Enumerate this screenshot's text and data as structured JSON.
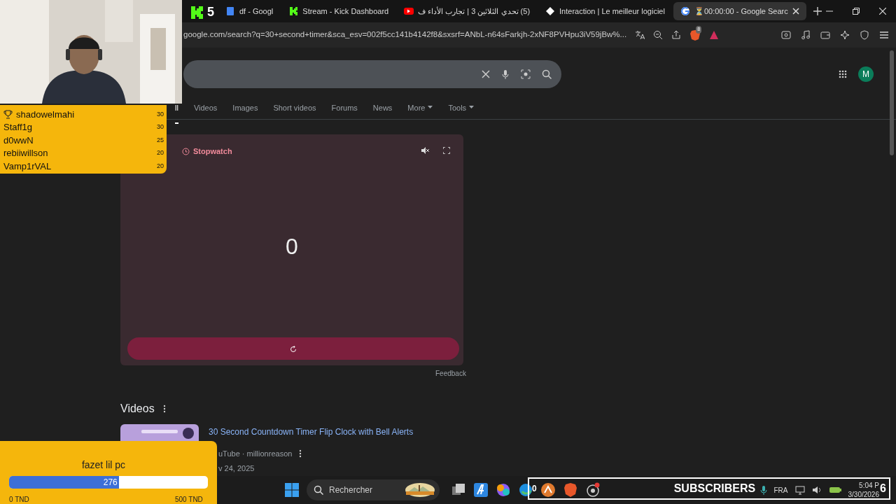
{
  "browser": {
    "tabs": [
      {
        "kind": "doc",
        "title": "df - Googl",
        "selected": false
      },
      {
        "kind": "kick",
        "title": "Stream - Kick Dashboard",
        "selected": false
      },
      {
        "kind": "youtube",
        "title": "(5) تحدي الثلاثين 3 | تجارب الأداء ف",
        "selected": false
      },
      {
        "kind": "diamond",
        "title": "Interaction | Le meilleur logiciel",
        "selected": false
      },
      {
        "kind": "google",
        "title": "⏳00:00:00 - Google Searc",
        "selected": true
      }
    ],
    "address": "google.com/search?q=30+second+timer&sca_esv=002f5cc141b4142f8&sxsrf=ANbL-n64sFarkjh-2xNF8PVHpu3iV59jBw%...",
    "shield_count": "8"
  },
  "google": {
    "avatar": "M",
    "nav": [
      {
        "label": "ll",
        "selected": true,
        "menu": false
      },
      {
        "label": "Videos",
        "selected": false,
        "menu": false
      },
      {
        "label": "Images",
        "selected": false,
        "menu": false
      },
      {
        "label": "Short videos",
        "selected": false,
        "menu": false
      },
      {
        "label": "Forums",
        "selected": false,
        "menu": false
      },
      {
        "label": "News",
        "selected": false,
        "menu": false
      },
      {
        "label": "More",
        "selected": false,
        "menu": true
      },
      {
        "label": "Tools",
        "selected": false,
        "menu": true
      }
    ],
    "stopwatch": {
      "title": "Stopwatch",
      "display": "0",
      "feedback": "Feedback"
    },
    "videos": {
      "heading": "Videos",
      "results": [
        {
          "title": "30 Second Countdown Timer Flip Clock with Bell Alerts",
          "source": "uTube · millionreason",
          "date": "v 24, 2025"
        }
      ]
    }
  },
  "taskbar": {
    "search": "Rechercher",
    "language": "FRA",
    "time": "5:04 P",
    "date": "3/30/2026"
  },
  "overlay": {
    "kick_count": "5",
    "leaderboard": [
      {
        "name": "shadowelmahi",
        "score": "30",
        "trophy": true
      },
      {
        "name": "Staff1g",
        "score": "30",
        "trophy": false
      },
      {
        "name": "d0wwN",
        "score": "25",
        "trophy": false
      },
      {
        "name": "rebiiwillson",
        "score": "20",
        "trophy": false
      },
      {
        "name": "Vamp1rVAL",
        "score": "20",
        "trophy": false
      }
    ],
    "goal": {
      "title": "fazet lil pc",
      "amount": "276",
      "level": 0.552,
      "min": "0 TND",
      "max": "500 TND"
    },
    "subscribers": {
      "left_count": "0",
      "label": "SUBSCRIBERS",
      "right_count": "6"
    }
  }
}
